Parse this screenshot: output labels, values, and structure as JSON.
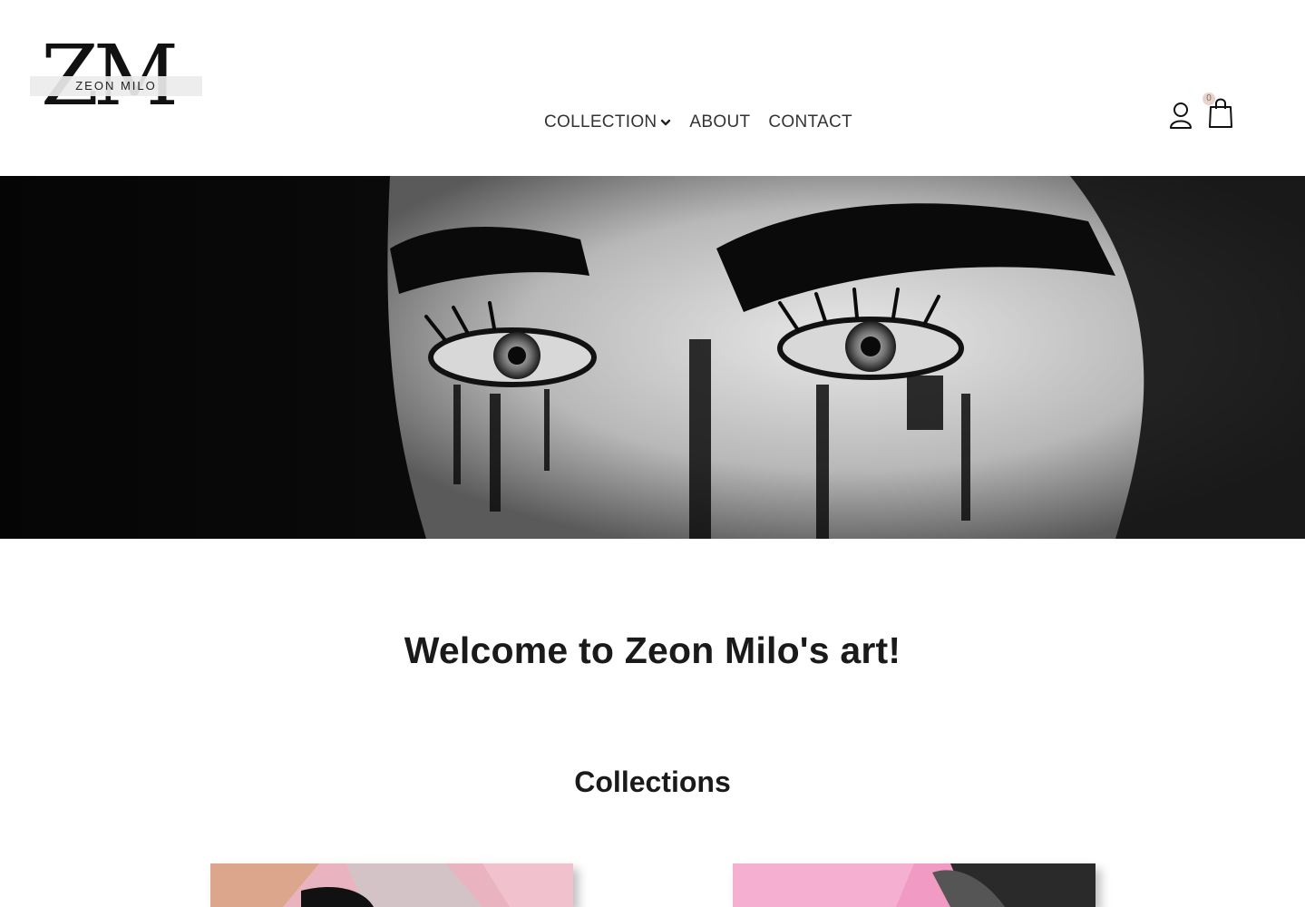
{
  "brand": {
    "logo_mark": "ZM",
    "logo_text": "ZEON MILO"
  },
  "nav": {
    "items": [
      {
        "label": "COLLECTION",
        "has_dropdown": true
      },
      {
        "label": "ABOUT"
      },
      {
        "label": "CONTACT"
      }
    ]
  },
  "header_icons": {
    "account_icon": "user-icon",
    "cart_icon": "shopping-bag-icon",
    "cart_count": "0"
  },
  "hero": {
    "image": "black-and-white painted face with eyes"
  },
  "main": {
    "welcome_heading": "Welcome to Zeon Milo's art!",
    "collections_heading": "Collections"
  },
  "colors": {
    "text": "#1a1a1a",
    "nav_text": "#333333",
    "badge_bg": "#e6d3cc",
    "hero_bg": "#0a0a0a"
  }
}
